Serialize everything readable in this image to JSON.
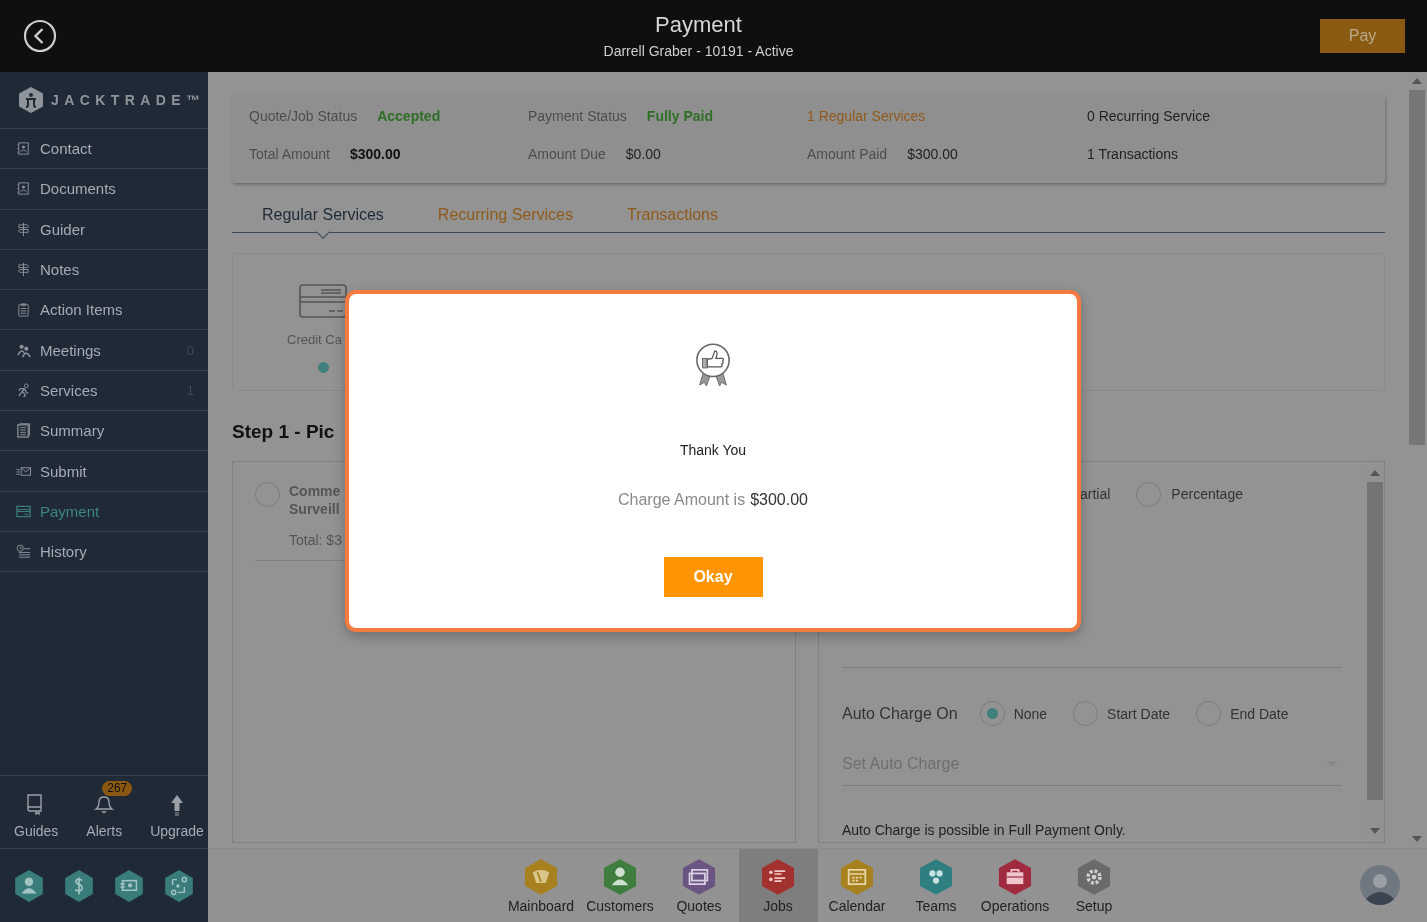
{
  "header": {
    "title": "Payment",
    "subtitle": "Darrell Graber - 10191 - Active",
    "pay_button": "Pay"
  },
  "sidebar": {
    "logo": "JACKTRADE",
    "logo_mark": "™",
    "items": [
      {
        "label": "Contact",
        "selected": false
      },
      {
        "label": "Documents",
        "selected": false
      },
      {
        "label": "Guider",
        "selected": false
      },
      {
        "label": "Notes",
        "selected": false
      },
      {
        "label": "Action Items",
        "selected": false
      },
      {
        "label": "Meetings",
        "count": "0",
        "selected": false
      },
      {
        "label": "Services",
        "count": "1",
        "selected": false
      },
      {
        "label": "Summary",
        "selected": false
      },
      {
        "label": "Submit",
        "selected": false
      },
      {
        "label": "Payment",
        "selected": true
      },
      {
        "label": "History",
        "selected": false
      }
    ],
    "tools": [
      {
        "label": "Guides"
      },
      {
        "label": "Alerts",
        "badge": "267"
      },
      {
        "label": "Upgrade"
      }
    ]
  },
  "summary": {
    "rows": [
      [
        {
          "kind": "status",
          "label": "Quote/Job Status",
          "value": "Accepted"
        },
        {
          "kind": "status",
          "label": "Payment Status",
          "value": "Fully Paid"
        },
        {
          "kind": "link",
          "text": "1 Regular Services"
        },
        {
          "kind": "text",
          "text": "0 Recurring Service"
        }
      ],
      [
        {
          "kind": "total",
          "label": "Total Amount",
          "value": "$300.00"
        },
        {
          "kind": "pair",
          "label": "Amount Due",
          "value": "$0.00"
        },
        {
          "kind": "pair",
          "label": "Amount Paid",
          "value": "$300.00"
        },
        {
          "kind": "text",
          "text": "1 Transactions"
        }
      ]
    ]
  },
  "tabs": [
    {
      "label": "Regular Services",
      "selected": true
    },
    {
      "label": "Recurring Services",
      "selected": false
    },
    {
      "label": "Transactions",
      "selected": false
    }
  ],
  "payment_method": {
    "label": "Credit Ca",
    "selected": true
  },
  "step_heading": "Step 1 - Pic",
  "service": {
    "name_lines": [
      "Comme",
      "Surveill"
    ],
    "total": "Total: $3",
    "selected": false
  },
  "payment_options": [
    {
      "kind": "label",
      "label": "artial"
    },
    {
      "kind": "radio",
      "label": "Percentage",
      "selected": false
    }
  ],
  "auto_charge": {
    "label": "Auto Charge On",
    "options": [
      {
        "label": "None",
        "selected": true
      },
      {
        "label": "Start Date",
        "selected": false
      },
      {
        "label": "End Date",
        "selected": false
      }
    ],
    "select_placeholder": "Set Auto Charge",
    "note": "Auto Charge is possible in Full Payment Only."
  },
  "bottom_nav": [
    {
      "label": "Mainboard",
      "color": "#a7801f",
      "selected": false
    },
    {
      "label": "Customers",
      "color": "#3f7d3f",
      "selected": false
    },
    {
      "label": "Quotes",
      "color": "#6c5482",
      "selected": false
    },
    {
      "label": "Jobs",
      "color": "#a3322e",
      "selected": true
    },
    {
      "label": "Calendar",
      "color": "#a7801f",
      "selected": false
    },
    {
      "label": "Teams",
      "color": "#2f7f80",
      "selected": false
    },
    {
      "label": "Operations",
      "color": "#a02a3e",
      "selected": false
    },
    {
      "label": "Setup",
      "color": "#6a6a6a",
      "selected": false
    }
  ],
  "dialog": {
    "title": "Thank You",
    "charge_label": "Charge Amount is",
    "charge_value": "$300.00",
    "button": "Okay"
  }
}
